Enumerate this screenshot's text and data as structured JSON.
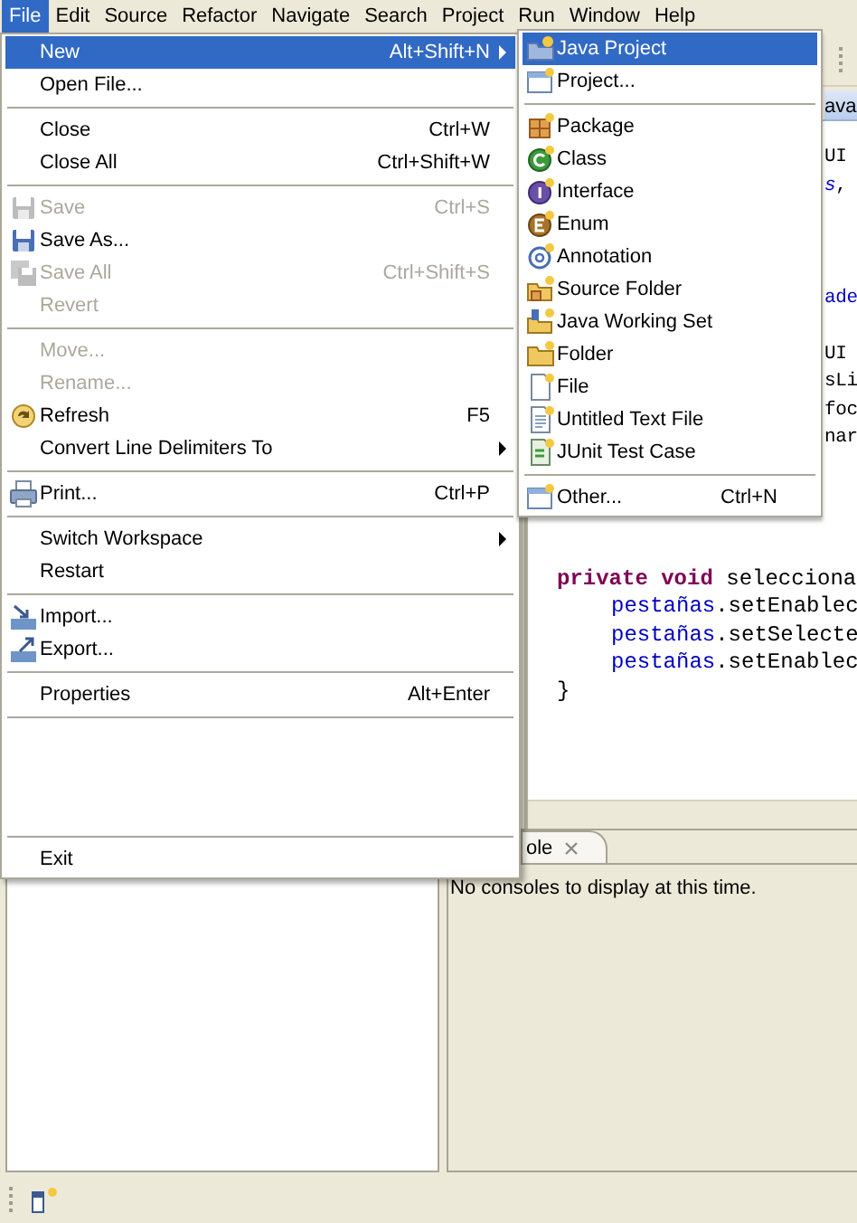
{
  "menu_bar": {
    "items": [
      {
        "label": "File",
        "selected": true
      },
      {
        "label": "Edit",
        "selected": false
      },
      {
        "label": "Source",
        "selected": false
      },
      {
        "label": "Refactor",
        "selected": false
      },
      {
        "label": "Navigate",
        "selected": false
      },
      {
        "label": "Search",
        "selected": false
      },
      {
        "label": "Project",
        "selected": false
      },
      {
        "label": "Run",
        "selected": false
      },
      {
        "label": "Window",
        "selected": false
      },
      {
        "label": "Help",
        "selected": false
      }
    ]
  },
  "file_menu": {
    "items": [
      {
        "kind": "command",
        "label": "New",
        "shortcut": "Alt+Shift+N",
        "submenu": true,
        "selected": true,
        "disabled": false
      },
      {
        "kind": "command",
        "label": "Open File...",
        "submenu": false,
        "selected": false,
        "disabled": false
      },
      {
        "kind": "separator"
      },
      {
        "kind": "command",
        "label": "Close",
        "shortcut": "Ctrl+W",
        "submenu": false,
        "selected": false,
        "disabled": false
      },
      {
        "kind": "command",
        "label": "Close All",
        "shortcut": "Ctrl+Shift+W",
        "submenu": false,
        "selected": false,
        "disabled": false
      },
      {
        "kind": "separator"
      },
      {
        "kind": "command",
        "label": "Save",
        "shortcut": "Ctrl+S",
        "submenu": false,
        "selected": false,
        "disabled": true
      },
      {
        "kind": "command",
        "label": "Save As...",
        "submenu": false,
        "selected": false,
        "disabled": false
      },
      {
        "kind": "command",
        "label": "Save All",
        "shortcut": "Ctrl+Shift+S",
        "submenu": false,
        "selected": false,
        "disabled": true
      },
      {
        "kind": "command",
        "label": "Revert",
        "submenu": false,
        "selected": false,
        "disabled": true
      },
      {
        "kind": "separator"
      },
      {
        "kind": "command",
        "label": "Move...",
        "submenu": false,
        "selected": false,
        "disabled": true
      },
      {
        "kind": "command",
        "label": "Rename...",
        "submenu": false,
        "selected": false,
        "disabled": true
      },
      {
        "kind": "command",
        "label": "Refresh",
        "shortcut": "F5",
        "submenu": false,
        "selected": false,
        "disabled": false
      },
      {
        "kind": "command",
        "label": "Convert Line Delimiters To",
        "submenu": true,
        "selected": false,
        "disabled": false
      },
      {
        "kind": "separator"
      },
      {
        "kind": "command",
        "label": "Print...",
        "shortcut": "Ctrl+P",
        "submenu": false,
        "selected": false,
        "disabled": false
      },
      {
        "kind": "separator"
      },
      {
        "kind": "command",
        "label": "Switch Workspace",
        "submenu": true,
        "selected": false,
        "disabled": false
      },
      {
        "kind": "command",
        "label": "Restart",
        "submenu": false,
        "selected": false,
        "disabled": false
      },
      {
        "kind": "separator"
      },
      {
        "kind": "command",
        "label": "Import...",
        "submenu": false,
        "selected": false,
        "disabled": false
      },
      {
        "kind": "command",
        "label": "Export...",
        "submenu": false,
        "selected": false,
        "disabled": false
      },
      {
        "kind": "separator"
      },
      {
        "kind": "command",
        "label": "Properties",
        "shortcut": "Alt+Enter",
        "submenu": false,
        "selected": false,
        "disabled": false
      },
      {
        "kind": "separator"
      },
      {
        "kind": "spacer"
      },
      {
        "kind": "separator"
      },
      {
        "kind": "command",
        "label": "Exit",
        "submenu": false,
        "selected": false,
        "disabled": false
      }
    ]
  },
  "new_submenu": {
    "items": [
      {
        "kind": "command",
        "label": "Java Project",
        "submenu": false,
        "selected": true,
        "disabled": false
      },
      {
        "kind": "command",
        "label": "Project...",
        "submenu": false,
        "selected": false,
        "disabled": false
      },
      {
        "kind": "separator"
      },
      {
        "kind": "command",
        "label": "Package",
        "submenu": false,
        "selected": false,
        "disabled": false
      },
      {
        "kind": "command",
        "label": "Class",
        "submenu": false,
        "selected": false,
        "disabled": false
      },
      {
        "kind": "command",
        "label": "Interface",
        "submenu": false,
        "selected": false,
        "disabled": false
      },
      {
        "kind": "command",
        "label": "Enum",
        "submenu": false,
        "selected": false,
        "disabled": false
      },
      {
        "kind": "command",
        "label": "Annotation",
        "submenu": false,
        "selected": false,
        "disabled": false
      },
      {
        "kind": "command",
        "label": "Source Folder",
        "submenu": false,
        "selected": false,
        "disabled": false
      },
      {
        "kind": "command",
        "label": "Java Working Set",
        "submenu": false,
        "selected": false,
        "disabled": false
      },
      {
        "kind": "command",
        "label": "Folder",
        "submenu": false,
        "selected": false,
        "disabled": false
      },
      {
        "kind": "command",
        "label": "File",
        "submenu": false,
        "selected": false,
        "disabled": false
      },
      {
        "kind": "command",
        "label": "Untitled Text File",
        "submenu": false,
        "selected": false,
        "disabled": false
      },
      {
        "kind": "command",
        "label": "JUnit Test Case",
        "submenu": false,
        "selected": false,
        "disabled": false
      },
      {
        "kind": "separator"
      },
      {
        "kind": "command",
        "label": "Other...",
        "shortcut": "Ctrl+N",
        "submenu": false,
        "selected": false,
        "disabled": false
      }
    ]
  },
  "editor": {
    "tab": "ava",
    "lines": [
      {
        "kind": "fragment",
        "segments": [
          {
            "kind": "plain",
            "text": "UI"
          }
        ]
      },
      {
        "kind": "fragment",
        "segments": [
          {
            "kind": "static",
            "text": "s"
          },
          {
            "kind": "plain",
            "text": ","
          }
        ]
      },
      {
        "kind": "blank"
      },
      {
        "kind": "blank"
      },
      {
        "kind": "blank"
      },
      {
        "kind": "fragment",
        "segments": [
          {
            "kind": "field",
            "text": "ade"
          }
        ]
      },
      {
        "kind": "blank"
      },
      {
        "kind": "fragment",
        "segments": [
          {
            "kind": "plain",
            "text": "UI"
          }
        ]
      },
      {
        "kind": "fragment",
        "segments": [
          {
            "kind": "plain",
            "text": "sLi"
          }
        ]
      },
      {
        "kind": "fragment",
        "segments": [
          {
            "kind": "plain",
            "text": "foc"
          }
        ]
      },
      {
        "kind": "fragment",
        "segments": [
          {
            "kind": "plain",
            "text": "nar"
          }
        ]
      },
      {
        "kind": "blank"
      },
      {
        "kind": "blank"
      },
      {
        "kind": "blank"
      },
      {
        "kind": "blank"
      },
      {
        "kind": "code",
        "segments": [
          {
            "kind": "keyword",
            "text": "private void"
          },
          {
            "kind": "plain",
            "text": " selecciona"
          }
        ],
        "children": [
          {
            "kind": "code",
            "segments": [
              {
                "kind": "field",
                "text": "pestañas"
              },
              {
                "kind": "plain",
                "text": ".setEnablec"
              }
            ]
          },
          {
            "kind": "code",
            "segments": [
              {
                "kind": "field",
                "text": "pestañas"
              },
              {
                "kind": "plain",
                "text": ".setSelecte"
              }
            ]
          },
          {
            "kind": "code",
            "segments": [
              {
                "kind": "field",
                "text": "pestañas"
              },
              {
                "kind": "plain",
                "text": ".setEnablec"
              }
            ]
          }
        ]
      },
      {
        "kind": "code",
        "segments": [
          {
            "kind": "plain",
            "text": "}"
          }
        ]
      }
    ]
  },
  "console": {
    "tab": "ole",
    "message": "No consoles to display at this time."
  }
}
